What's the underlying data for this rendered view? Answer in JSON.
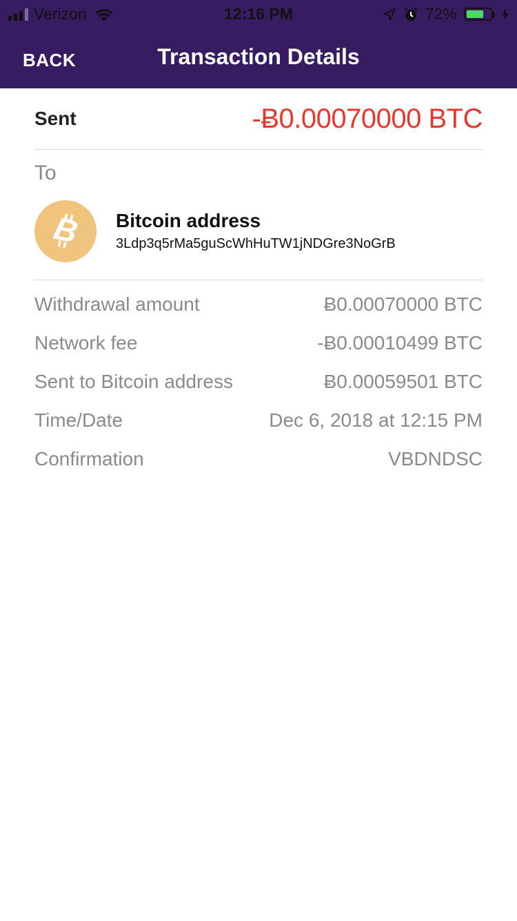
{
  "status_bar": {
    "carrier": "Verizon",
    "time": "12:16 PM",
    "battery": "72%",
    "battery_level": 0.72
  },
  "header": {
    "back_label": "BACK",
    "title": "Transaction Details"
  },
  "summary": {
    "label": "Sent",
    "amount": "-Ƀ0.00070000 BTC"
  },
  "recipient": {
    "section_label": "To",
    "icon": "bitcoin-icon",
    "title": "Bitcoin address",
    "address": "3Ldp3q5rMa5guScWhHuTW1jNDGre3NoGrB"
  },
  "details": [
    {
      "label": "Withdrawal amount",
      "value": "Ƀ0.00070000 BTC"
    },
    {
      "label": "Network fee",
      "value": "-Ƀ0.00010499 BTC"
    },
    {
      "label": "Sent to Bitcoin address",
      "value": "Ƀ0.00059501 BTC"
    },
    {
      "label": "Time/Date",
      "value": "Dec 6, 2018 at 12:15 PM"
    },
    {
      "label": "Confirmation",
      "value": "VBDNDSC"
    }
  ],
  "colors": {
    "header_bg": "#371c62",
    "sent_amount": "#e8372c",
    "bitcoin_icon_bg": "#f0c47e",
    "battery_fill": "#4cd964"
  }
}
